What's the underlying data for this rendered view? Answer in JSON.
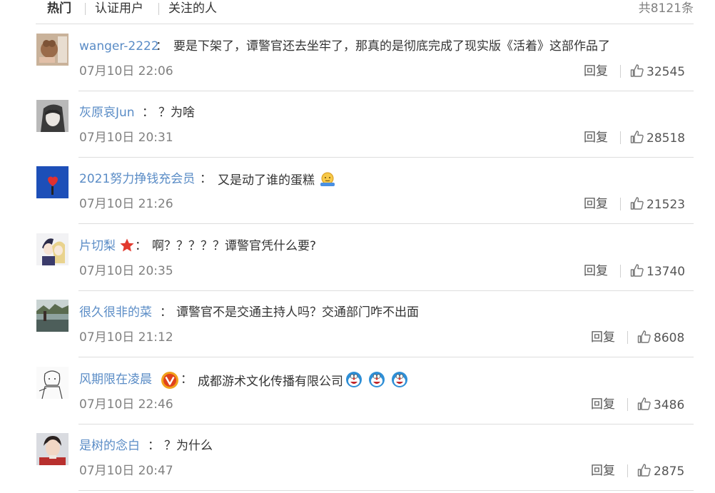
{
  "tabs": {
    "hot": "热门",
    "verified": "认证用户",
    "following": "关注的人",
    "total": "共8121条"
  },
  "comments": [
    {
      "user": "wanger-2222",
      "colon": "：",
      "text": "要是下架了，谭警官还去坐牢了，那真的是彻底完成了现实版《活着》这部作品了",
      "time": "07月10日 22:06",
      "reply": "回复",
      "likes": "32545"
    },
    {
      "user": "灰原哀Jun",
      "colon": "：",
      "text": "？为啥",
      "time": "07月10日 20:31",
      "reply": "回复",
      "likes": "28518"
    },
    {
      "user": "2021努力挣钱充会员",
      "colon": "：",
      "text": "又是动了谁的蛋糕",
      "time": "07月10日 21:26",
      "reply": "回复",
      "likes": "21523"
    },
    {
      "user": "片切梨",
      "colon": "：",
      "text": "啊？？？？？谭警官凭什么要?",
      "time": "07月10日 20:35",
      "reply": "回复",
      "likes": "13740"
    },
    {
      "user": "很久很非的菜",
      "colon": "：",
      "text": "谭警官不是交通主持人吗？交通部门咋不出面",
      "time": "07月10日 21:12",
      "reply": "回复",
      "likes": "8608"
    },
    {
      "user": "风期限在凌晨",
      "colon": "：",
      "text": "成都游术文化传播有限公司",
      "time": "07月10日 22:46",
      "reply": "回复",
      "likes": "3486"
    },
    {
      "user": "是树的念白",
      "colon": "：",
      "text": "？为什么",
      "time": "07月10日 20:47",
      "reply": "回复",
      "likes": "2875"
    }
  ],
  "colors": {
    "link": "#5a8cc6",
    "gray": "#808080",
    "divider": "#dddddd"
  },
  "icons": {
    "like": "thumb-up-icon",
    "emoji_shrug": "shrug-emoji",
    "emoji_doraemon": "doraemon-emoji",
    "star": "star-badge-icon",
    "vip": "vip-badge-icon"
  }
}
